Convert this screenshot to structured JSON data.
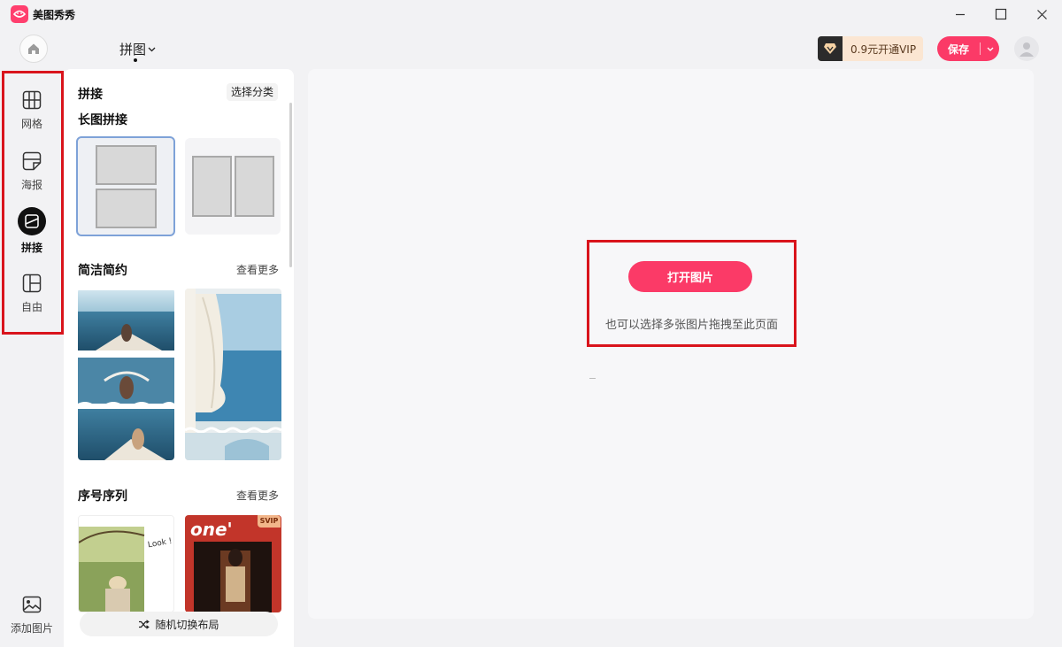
{
  "app": {
    "name": "美图秀秀",
    "mode_title": "拼图"
  },
  "header": {
    "vip_label": "0.9元开通VIP",
    "save_label": "保存"
  },
  "rail": {
    "items": [
      {
        "label": "网格",
        "icon": "grid-icon"
      },
      {
        "label": "海报",
        "icon": "poster-icon"
      },
      {
        "label": "拼接",
        "icon": "stitch-icon",
        "active": true
      },
      {
        "label": "自由",
        "icon": "free-layout-icon"
      }
    ],
    "add_photo_label": "添加图片"
  },
  "panel": {
    "header_title": "拼接",
    "category_chip": "选择分类",
    "sections": [
      {
        "title": "长图拼接",
        "link": ""
      },
      {
        "title": "简洁简约",
        "link": "查看更多"
      },
      {
        "title": "序号序列",
        "link": "查看更多"
      }
    ],
    "shuffle_label": "随机切换布局",
    "svip_badge": "SVIP",
    "card_texts": {
      "look": "Look !",
      "one": "one'"
    }
  },
  "canvas": {
    "open_button_label": "打开图片",
    "drop_hint": "也可以选择多张图片拖拽至此页面"
  },
  "colors": {
    "accent": "#fb3a67",
    "highlight_border": "#d9141c",
    "vip_bg": "#fbe6d2"
  }
}
